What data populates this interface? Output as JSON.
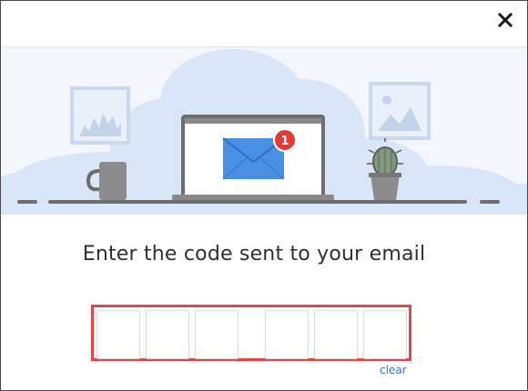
{
  "dialog": {
    "close_icon": "close-icon",
    "illustration": {
      "notification_count": "1",
      "accent_color": "#4a90e2",
      "badge_color": "#e53935",
      "icons": [
        "cloud-icon",
        "picture-frame-icon",
        "laptop-icon",
        "envelope-icon",
        "mug-icon",
        "cactus-plant-icon"
      ]
    },
    "title": "Enter the code sent to your email",
    "code_inputs": [
      {
        "value": ""
      },
      {
        "value": ""
      },
      {
        "value": ""
      },
      {
        "value": ""
      },
      {
        "value": ""
      },
      {
        "value": ""
      }
    ],
    "clear_label": "clear",
    "highlight_color": "#e04848"
  }
}
